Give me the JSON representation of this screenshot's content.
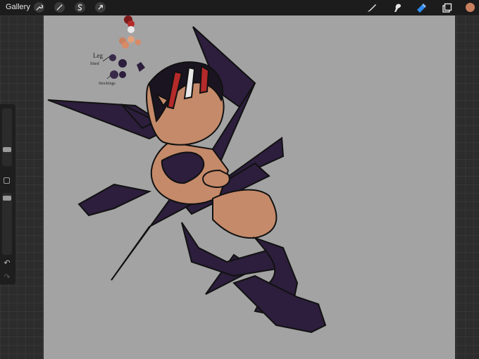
{
  "top_bar": {
    "gallery_label": "Gallery",
    "left_tools": [
      "wrench-icon",
      "magic-wand-icon",
      "selection-s-icon",
      "transform-arrow-icon"
    ],
    "right_tools": [
      "brush-icon",
      "smudge-icon",
      "eraser-icon",
      "layers-icon"
    ],
    "active_tool": "eraser-icon",
    "current_color": "#c9805f"
  },
  "sidebar": {
    "brush_size_level": 0.34,
    "opacity_level": 0.12,
    "undo_icon": "undo-icon",
    "redo_icon": "redo-icon"
  },
  "canvas": {
    "background": "#a3a3a3",
    "notes": [
      "Leg",
      "Stockings"
    ],
    "palette": [
      "#7d1a1a",
      "#b52a2a",
      "#e8e8e8",
      "#c9805f",
      "#e3a07a",
      "#d98a66",
      "#3a2a4a",
      "#2c1e3c"
    ]
  }
}
